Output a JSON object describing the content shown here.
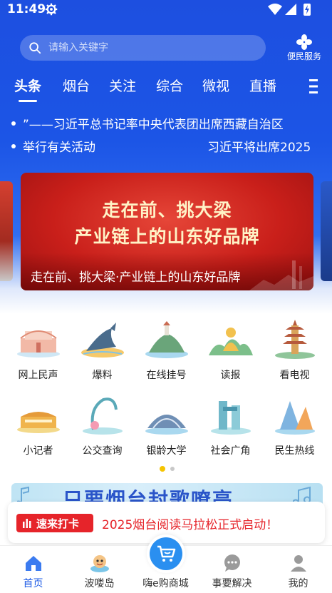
{
  "status_bar": {
    "time": "11:49",
    "icons": [
      "gear-icon",
      "wifi-icon",
      "signal-icon",
      "battery-icon"
    ]
  },
  "search": {
    "placeholder": "请输入关键字"
  },
  "services": {
    "label": "便民服务",
    "icon": "grid-four-icon"
  },
  "tabs": [
    {
      "label": "头条",
      "active": true
    },
    {
      "label": "烟台",
      "active": false
    },
    {
      "label": "关注",
      "active": false
    },
    {
      "label": "综合",
      "active": false
    },
    {
      "label": "微视",
      "active": false
    },
    {
      "label": "直播",
      "active": false
    }
  ],
  "ticker": {
    "line1": "”——习近平总书记率中央代表团出席西藏自治区",
    "line2_left": "举行有关活动",
    "line2_right": "习近平将出席2025"
  },
  "banner": {
    "headline1": "走在前、挑大梁",
    "headline2": "产业链上的山东好品牌",
    "caption": "走在前、挑大梁·产业链上的山东好品牌"
  },
  "grid": {
    "row1": [
      {
        "label": "网上民声",
        "icon": "building-icon"
      },
      {
        "label": "爆料",
        "icon": "whale-icon"
      },
      {
        "label": "在线挂号",
        "icon": "island-icon"
      },
      {
        "label": "读报",
        "icon": "buddha-icon"
      },
      {
        "label": "看电视",
        "icon": "pagoda-icon"
      }
    ],
    "row2": [
      {
        "label": "小记者",
        "icon": "stadium-icon"
      },
      {
        "label": "公交查询",
        "icon": "sculpture-icon"
      },
      {
        "label": "银龄大学",
        "icon": "dome-icon"
      },
      {
        "label": "社会广角",
        "icon": "towers-icon"
      },
      {
        "label": "民生热线",
        "icon": "sail-building-icon"
      }
    ]
  },
  "pager": {
    "count": 2,
    "active": 0
  },
  "promo": {
    "title": "只要烟台封歌嘹亮"
  },
  "notice": {
    "badge": "速来打卡",
    "text": "2025烟台阅读马拉松正式启动！"
  },
  "nav": [
    {
      "label": "首页",
      "icon": "home-icon",
      "active": true
    },
    {
      "label": "波喽岛",
      "icon": "mascot-icon",
      "active": false
    },
    {
      "label": "嗨e购商城",
      "icon": "shopping-cart-icon",
      "active": false
    },
    {
      "label": "事要解决",
      "icon": "chat-bubble-icon",
      "active": false
    },
    {
      "label": "我的",
      "icon": "user-icon",
      "active": false
    }
  ],
  "colors": {
    "primary_blue": "#1d4fe0",
    "accent_red": "#e6242a",
    "active_nav": "#1d5be6",
    "pager_active": "#f5c400"
  }
}
